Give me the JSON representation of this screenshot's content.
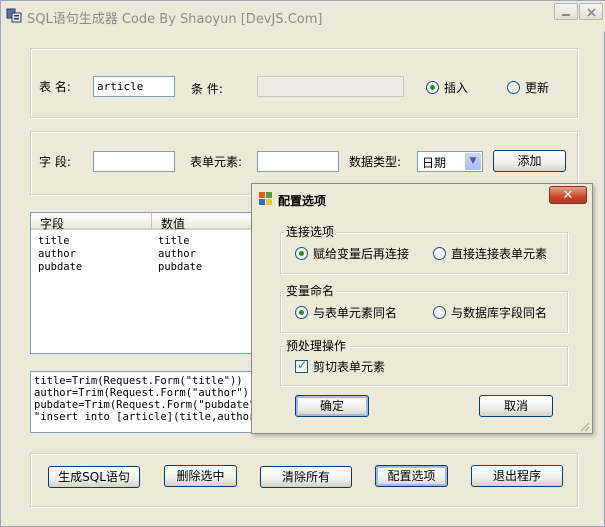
{
  "window": {
    "title": "SQL语句生成器  Code By Shaoyun  [DevJS.Com]"
  },
  "row1": {
    "table_label": "表  名:",
    "table_value": "article",
    "condition_label": "条    件:",
    "condition_value": "",
    "insert_label": "插入",
    "update_label": "更新",
    "insert_selected": true
  },
  "row2": {
    "field_label": "字  段:",
    "field_value": "",
    "form_element_label": "表单元素:",
    "form_element_value": "",
    "data_type_label": "数据类型:",
    "data_type_value": "日期",
    "add_label": "添加"
  },
  "list": {
    "columns": [
      "字段",
      "数值"
    ],
    "rows": [
      [
        "title",
        "title"
      ],
      [
        "author",
        "author"
      ],
      [
        "pubdate",
        "pubdate"
      ]
    ]
  },
  "output": {
    "lines": [
      "title=Trim(Request.Form(\"title\"))",
      "author=Trim(Request.Form(\"author\"))",
      "pubdate=Trim(Request.Form(\"pubdate\"))",
      "\"insert into [article](title,author,p"
    ]
  },
  "bottom": {
    "generate_label": "生成SQL语句",
    "delete_label": "删除选中",
    "clear_label": "清除所有",
    "config_label": "配置选项",
    "exit_label": "退出程序"
  },
  "dialog": {
    "title": "配置选项",
    "connection": {
      "legend": "连接选项",
      "opt1": "赋给变量后再连接",
      "opt2": "直接连接表单元素",
      "selected": 1
    },
    "naming": {
      "legend": "变量命名",
      "opt1": "与表单元素同名",
      "opt2": "与数据库字段同名",
      "selected": 1
    },
    "preprocess": {
      "legend": "预处理操作",
      "cut_label": "剪切表单元素",
      "cut_checked": true
    },
    "ok_label": "确定",
    "cancel_label": "取消",
    "close_glyph": "✕"
  }
}
